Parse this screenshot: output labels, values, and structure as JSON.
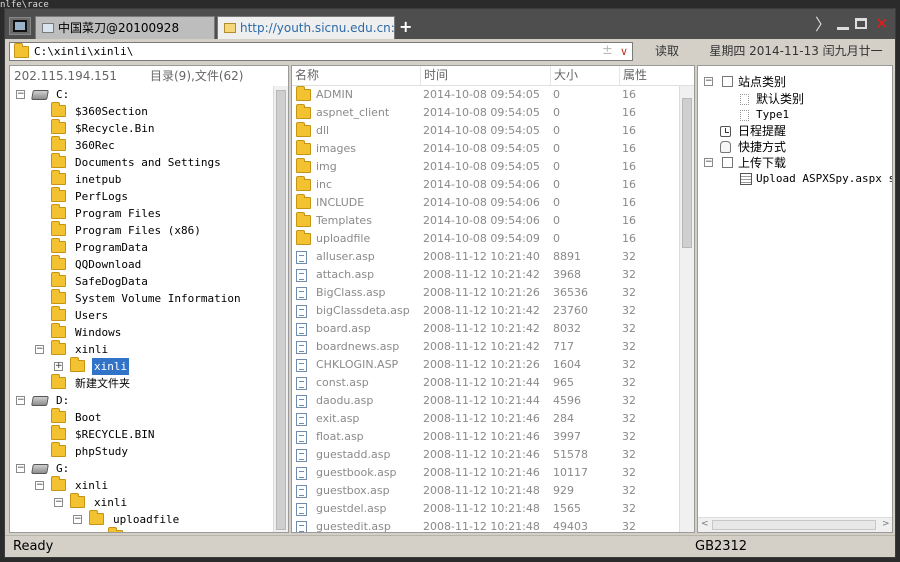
{
  "stray_text": "nlfe\\race",
  "tabs": [
    {
      "label": "中国菜刀@20100928"
    },
    {
      "label": "http://youth.sicnu.edu.cn:252..."
    }
  ],
  "new_tab_label": "+",
  "window_controls": {
    "chevron": "〉",
    "close": "✕"
  },
  "address": {
    "path": "C:\\xinli\\xinli\\",
    "spin": "±",
    "dropdown": "∨"
  },
  "read_button": "读取",
  "date_text": "星期四 2014-11-13 闰九月廿一",
  "left": {
    "ip": "202.115.194.151",
    "count": "目录(9),文件(62)",
    "tree": [
      {
        "label": "C:",
        "type": "drive",
        "exp": "⊟"
      },
      {
        "label": "$360Section",
        "type": "folder"
      },
      {
        "label": "$Recycle.Bin",
        "type": "folder"
      },
      {
        "label": "360Rec",
        "type": "folder"
      },
      {
        "label": "Documents and Settings",
        "type": "folder"
      },
      {
        "label": "inetpub",
        "type": "folder"
      },
      {
        "label": "PerfLogs",
        "type": "folder"
      },
      {
        "label": "Program Files",
        "type": "folder"
      },
      {
        "label": "Program Files (x86)",
        "type": "folder"
      },
      {
        "label": "ProgramData",
        "type": "folder"
      },
      {
        "label": "QQDownload",
        "type": "folder"
      },
      {
        "label": "SafeDogData",
        "type": "folder"
      },
      {
        "label": "System Volume Information",
        "type": "folder"
      },
      {
        "label": "Users",
        "type": "folder"
      },
      {
        "label": "Windows",
        "type": "folder"
      },
      {
        "label": "xinli",
        "type": "folder",
        "exp": "⊟"
      },
      {
        "label": "xinli",
        "type": "folder",
        "exp": "⊞",
        "selected": true
      },
      {
        "label": "新建文件夹",
        "type": "folder"
      },
      {
        "label": "D:",
        "type": "drive",
        "exp": "⊟"
      },
      {
        "label": "Boot",
        "type": "folder"
      },
      {
        "label": "$RECYCLE.BIN",
        "type": "folder"
      },
      {
        "label": "phpStudy",
        "type": "folder"
      },
      {
        "label": "G:",
        "type": "drive",
        "exp": "⊟"
      },
      {
        "label": "xinli",
        "type": "folder",
        "exp": "⊟"
      },
      {
        "label": "xinli",
        "type": "folder",
        "exp": "⊟"
      },
      {
        "label": "uploadfile",
        "type": "folder",
        "exp": "⊟"
      },
      {
        "label": "f",
        "type": "folder"
      }
    ]
  },
  "files": {
    "headers": {
      "name": "名称",
      "time": "时间",
      "size": "大小",
      "attr": "属性"
    },
    "rows": [
      {
        "name": "ADMIN",
        "time": "2014-10-08 09:54:05",
        "size": "0",
        "attr": "16",
        "type": "folder"
      },
      {
        "name": "aspnet_client",
        "time": "2014-10-08 09:54:05",
        "size": "0",
        "attr": "16",
        "type": "folder"
      },
      {
        "name": "dll",
        "time": "2014-10-08 09:54:05",
        "size": "0",
        "attr": "16",
        "type": "folder"
      },
      {
        "name": "images",
        "time": "2014-10-08 09:54:05",
        "size": "0",
        "attr": "16",
        "type": "folder"
      },
      {
        "name": "img",
        "time": "2014-10-08 09:54:05",
        "size": "0",
        "attr": "16",
        "type": "folder"
      },
      {
        "name": "inc",
        "time": "2014-10-08 09:54:06",
        "size": "0",
        "attr": "16",
        "type": "folder"
      },
      {
        "name": "INCLUDE",
        "time": "2014-10-08 09:54:06",
        "size": "0",
        "attr": "16",
        "type": "folder"
      },
      {
        "name": "Templates",
        "time": "2014-10-08 09:54:06",
        "size": "0",
        "attr": "16",
        "type": "folder"
      },
      {
        "name": "uploadfile",
        "time": "2014-10-08 09:54:09",
        "size": "0",
        "attr": "16",
        "type": "folder"
      },
      {
        "name": "alluser.asp",
        "time": "2008-11-12 10:21:40",
        "size": "8891",
        "attr": "32",
        "type": "file"
      },
      {
        "name": "attach.asp",
        "time": "2008-11-12 10:21:42",
        "size": "3968",
        "attr": "32",
        "type": "file"
      },
      {
        "name": "BigClass.asp",
        "time": "2008-11-12 10:21:26",
        "size": "36536",
        "attr": "32",
        "type": "file"
      },
      {
        "name": "bigClassdeta.asp",
        "time": "2008-11-12 10:21:42",
        "size": "23760",
        "attr": "32",
        "type": "file"
      },
      {
        "name": "board.asp",
        "time": "2008-11-12 10:21:42",
        "size": "8032",
        "attr": "32",
        "type": "file"
      },
      {
        "name": "boardnews.asp",
        "time": "2008-11-12 10:21:42",
        "size": "717",
        "attr": "32",
        "type": "file"
      },
      {
        "name": "CHKLOGIN.ASP",
        "time": "2008-11-12 10:21:26",
        "size": "1604",
        "attr": "32",
        "type": "file"
      },
      {
        "name": "const.asp",
        "time": "2008-11-12 10:21:44",
        "size": "965",
        "attr": "32",
        "type": "file"
      },
      {
        "name": "daodu.asp",
        "time": "2008-11-12 10:21:44",
        "size": "4596",
        "attr": "32",
        "type": "file"
      },
      {
        "name": "exit.asp",
        "time": "2008-11-12 10:21:46",
        "size": "284",
        "attr": "32",
        "type": "file"
      },
      {
        "name": "float.asp",
        "time": "2008-11-12 10:21:46",
        "size": "3997",
        "attr": "32",
        "type": "file"
      },
      {
        "name": "guestadd.asp",
        "time": "2008-11-12 10:21:46",
        "size": "51578",
        "attr": "32",
        "type": "file"
      },
      {
        "name": "guestbook.asp",
        "time": "2008-11-12 10:21:46",
        "size": "10117",
        "attr": "32",
        "type": "file"
      },
      {
        "name": "guestbox.asp",
        "time": "2008-11-12 10:21:48",
        "size": "929",
        "attr": "32",
        "type": "file"
      },
      {
        "name": "guestdel.asp",
        "time": "2008-11-12 10:21:48",
        "size": "1565",
        "attr": "32",
        "type": "file"
      },
      {
        "name": "guestedit.asp",
        "time": "2008-11-12 10:21:48",
        "size": "49403",
        "attr": "32",
        "type": "file"
      }
    ]
  },
  "right": {
    "tree": [
      {
        "label": "站点类别",
        "kind": "check",
        "exp": "⊟"
      },
      {
        "label": "默认类别",
        "kind": "doc"
      },
      {
        "label": "Type1",
        "kind": "doc",
        "mono": true
      },
      {
        "label": "日程提醒",
        "kind": "clock"
      },
      {
        "label": "快捷方式",
        "kind": "hand"
      },
      {
        "label": "上传下载",
        "kind": "check",
        "exp": "⊟"
      },
      {
        "label": "Upload ASPXSpy.aspx suc",
        "kind": "sheet",
        "mono": true
      }
    ]
  },
  "status": {
    "left": "Ready",
    "encoding": "GB2312"
  },
  "colors": {
    "selection": "#3173c8",
    "folder": "#f2c230",
    "close": "#e11d1d",
    "url": "#2c6aa8"
  }
}
